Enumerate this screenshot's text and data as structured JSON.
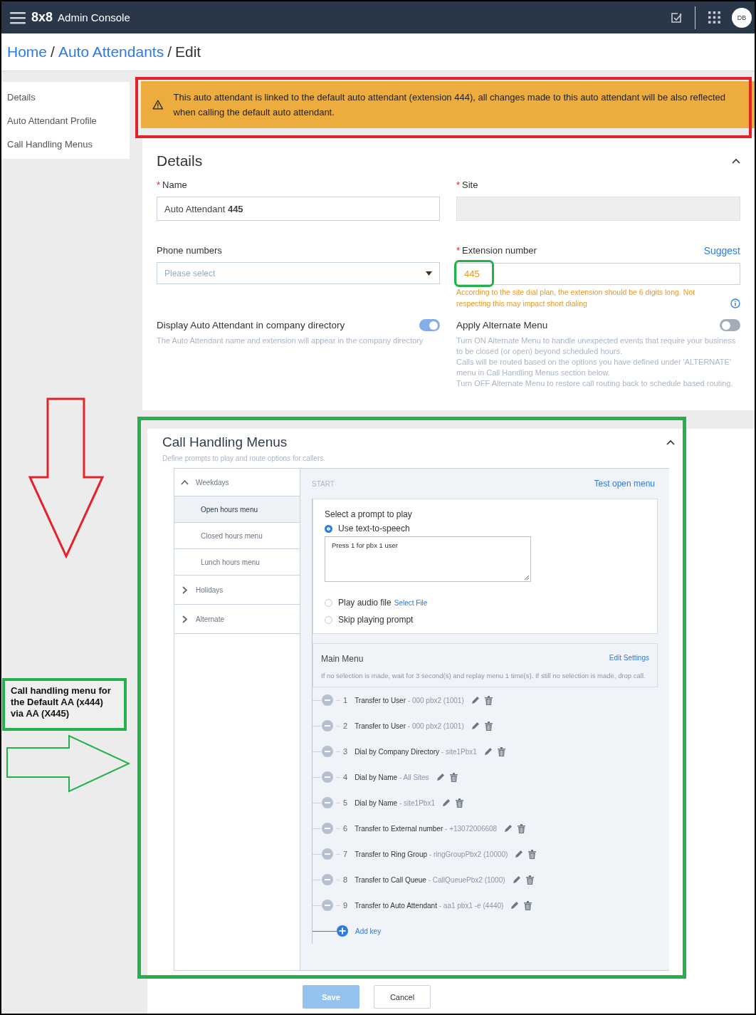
{
  "topbar": {
    "brand": "8x8",
    "title": "Admin Console",
    "avatar": "DB"
  },
  "breadcrumb": [
    {
      "label": "Home",
      "kind": "link"
    },
    {
      "label": "/",
      "kind": "separator"
    },
    {
      "label": "Auto Attendants",
      "kind": "link"
    },
    {
      "label": "/",
      "kind": "separator"
    },
    {
      "label": "Edit",
      "kind": "current"
    }
  ],
  "sidebar": [
    {
      "label": "Details"
    },
    {
      "label": "Auto Attendant Profile"
    },
    {
      "label": "Call Handling Menus"
    }
  ],
  "warning": {
    "text": "This auto attendant is linked to the default auto attendant (extension 444), all changes made to this auto attendant will be also reflected when calling the default auto attendant."
  },
  "details": {
    "title": "Details",
    "expanded": true,
    "name": {
      "label": "Name",
      "required_mark": "*",
      "value": "Auto Attendant **445**"
    },
    "site": {
      "label": "Site",
      "required_mark": "*",
      "disabled": true
    },
    "phone": {
      "label": "Phone numbers",
      "placeholder": "Please select"
    },
    "extension": {
      "label": "Extension number",
      "required_mark": "*",
      "value": "445",
      "action": "Suggest",
      "warning": "According to the site dial plan, the extension should be 6 digits long. Not respecting this may impact short dialing"
    },
    "toggles": [
      {
        "label": "Display Auto Attendant in company directory",
        "on": true,
        "help": [
          "The Auto Attendant name and extension will appear in the company directory"
        ]
      },
      {
        "label": "Apply Alternate Menu",
        "on": false,
        "help": [
          "Turn ON Alternate Menu to handle unexpected events that require your business to be closed (or open) beyond scheduled hours.",
          "Calls will be routed based on the options you have defined under 'ALTERNATE' menu in Call Handling Menus section below.",
          "Turn OFF Alternate Menu to restore call routing back to schedule based routing."
        ]
      }
    ]
  },
  "call_handling": {
    "title": "Call Handling Menus",
    "subtitle": "Define prompts to play and route options for callers.",
    "expanded": true,
    "tree": [
      {
        "label": "Weekdays",
        "expanded": true,
        "children": [
          {
            "label": "Open hours menu",
            "selected": true
          },
          {
            "label": "Closed hours menu",
            "selected": false
          },
          {
            "label": "Lunch hours menu",
            "selected": false
          }
        ]
      },
      {
        "label": "Holidays",
        "expanded": false
      },
      {
        "label": "Alternate",
        "expanded": false
      }
    ],
    "start_label": "START",
    "test_link": "Test open menu",
    "prompt": {
      "title": "Select a prompt to play",
      "options": [
        {
          "kind": "tts",
          "label": "Use text-to-speech",
          "selected": true,
          "text": "Press 1 for pbx 1 user"
        },
        {
          "kind": "file",
          "label": "Play audio file",
          "link": "Select File",
          "selected": false
        },
        {
          "kind": "skip",
          "label": "Skip playing prompt",
          "selected": false
        }
      ]
    },
    "main_menu": {
      "title": "Main Menu",
      "action": "Edit Settings",
      "note": "If no selection is made, wait for 3 second(s) and replay menu 1 time(s). If still no selection is made, drop call.",
      "keys": [
        {
          "key": "1",
          "action": "Transfer to User",
          "target": "- 000 pbx2 (1001)"
        },
        {
          "key": "2",
          "action": "Transfer to User",
          "target": "- 000 pbx2 (1001)"
        },
        {
          "key": "3",
          "action": "Dial by Company Directory",
          "target": "- site1Pbx1"
        },
        {
          "key": "4",
          "action": "Dial by Name",
          "target": "- All Sites"
        },
        {
          "key": "5",
          "action": "Dial by Name",
          "target": "- site1Pbx1"
        },
        {
          "key": "6",
          "action": "Transfer to External number",
          "target": "- +13072006608"
        },
        {
          "key": "7",
          "action": "Transfer to Ring Group",
          "target": "- ringGroupPbx2 (10000)"
        },
        {
          "key": "8",
          "action": "Transfer to Call Queue",
          "target": "- CallQueuePbx2 (1000)"
        },
        {
          "key": "9",
          "action": "Transfer to Auto Attendant",
          "target": "- aa1 pbx1 -e (4440)"
        }
      ],
      "add": "Add key"
    }
  },
  "buttons": [
    {
      "label": "Save",
      "kind": "primary",
      "disabled": true
    },
    {
      "label": "Cancel",
      "kind": "secondary",
      "disabled": false
    }
  ],
  "annotation": {
    "note": "Call handling menu for the Default AA (x444) via AA (X445)"
  }
}
